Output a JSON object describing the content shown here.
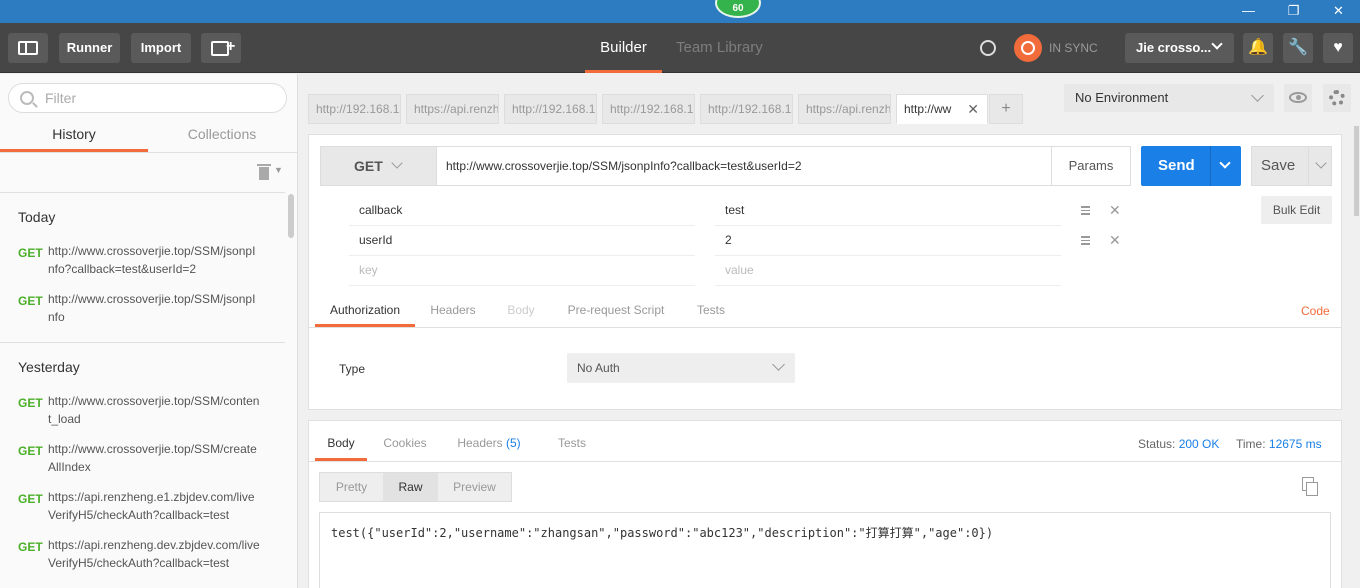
{
  "titlebar": {
    "fps_badge": "60",
    "minimize": "—",
    "restore": "❐",
    "close": "✕"
  },
  "toolbar": {
    "runner_label": "Runner",
    "import_label": "Import",
    "builder_tab": "Builder",
    "team_library_tab": "Team Library",
    "sync_status": "IN SYNC",
    "user_name": "Jie crosso...",
    "user_chevron": "⌵",
    "bell_icon": "🔔",
    "wrench_icon": "🔧",
    "heart_icon": "♥"
  },
  "sidebar": {
    "filter_placeholder": "Filter",
    "tabs": [
      "History",
      "Collections"
    ],
    "groups": [
      {
        "title": "Today",
        "items": [
          {
            "method": "GET",
            "url": "http://www.crossoverjie.top/SSM/jsonpInfo?callback=test&userId=2"
          },
          {
            "method": "GET",
            "url": "http://www.crossoverjie.top/SSM/jsonpInfo"
          }
        ]
      },
      {
        "title": "Yesterday",
        "items": [
          {
            "method": "GET",
            "url": "http://www.crossoverjie.top/SSM/content_load"
          },
          {
            "method": "GET",
            "url": "http://www.crossoverjie.top/SSM/createAllIndex"
          },
          {
            "method": "GET",
            "url": "https://api.renzheng.e1.zbjdev.com/liveVerifyH5/checkAuth?callback=test"
          },
          {
            "method": "GET",
            "url": "https://api.renzheng.dev.zbjdev.com/liveVerifyH5/checkAuth?callback=test"
          }
        ]
      }
    ]
  },
  "request_tabs": [
    {
      "label": "http://192.168.1",
      "active": false
    },
    {
      "label": "https://api.renzh",
      "active": false
    },
    {
      "label": "http://192.168.1",
      "active": false
    },
    {
      "label": "http://192.168.1",
      "active": false
    },
    {
      "label": "http://192.168.1",
      "active": false
    },
    {
      "label": "https://api.renzh",
      "active": false
    },
    {
      "label": "http://ww",
      "active": true
    }
  ],
  "request_tab_close": "✕",
  "new_tab": "+",
  "environment": {
    "selected": "No Environment"
  },
  "request": {
    "method": "GET",
    "url": "http://www.crossoverjie.top/SSM/jsonpInfo?callback=test&userId=2",
    "params_label": "Params",
    "send_label": "Send",
    "save_label": "Save",
    "bulk_edit_label": "Bulk Edit",
    "params": [
      {
        "key": "callback",
        "value": "test"
      },
      {
        "key": "userId",
        "value": "2"
      }
    ],
    "key_placeholder": "key",
    "value_placeholder": "value",
    "row_delete": "✕",
    "sub_tabs": [
      "Authorization",
      "Headers",
      "Body",
      "Pre-request Script",
      "Tests"
    ],
    "code_link": "Code",
    "auth": {
      "type_label": "Type",
      "type_value": "No Auth"
    }
  },
  "response": {
    "tabs": [
      "Body",
      "Cookies",
      "Headers",
      "Tests"
    ],
    "headers_count": "(5)",
    "status_label": "Status:",
    "status_value": "200 OK",
    "time_label": "Time:",
    "time_value": "12675 ms",
    "formats": [
      "Pretty",
      "Raw",
      "Preview"
    ],
    "body": "test({\"userId\":2,\"username\":\"zhangsan\",\"password\":\"abc123\",\"description\":\"打算打算\",\"age\":0})"
  }
}
